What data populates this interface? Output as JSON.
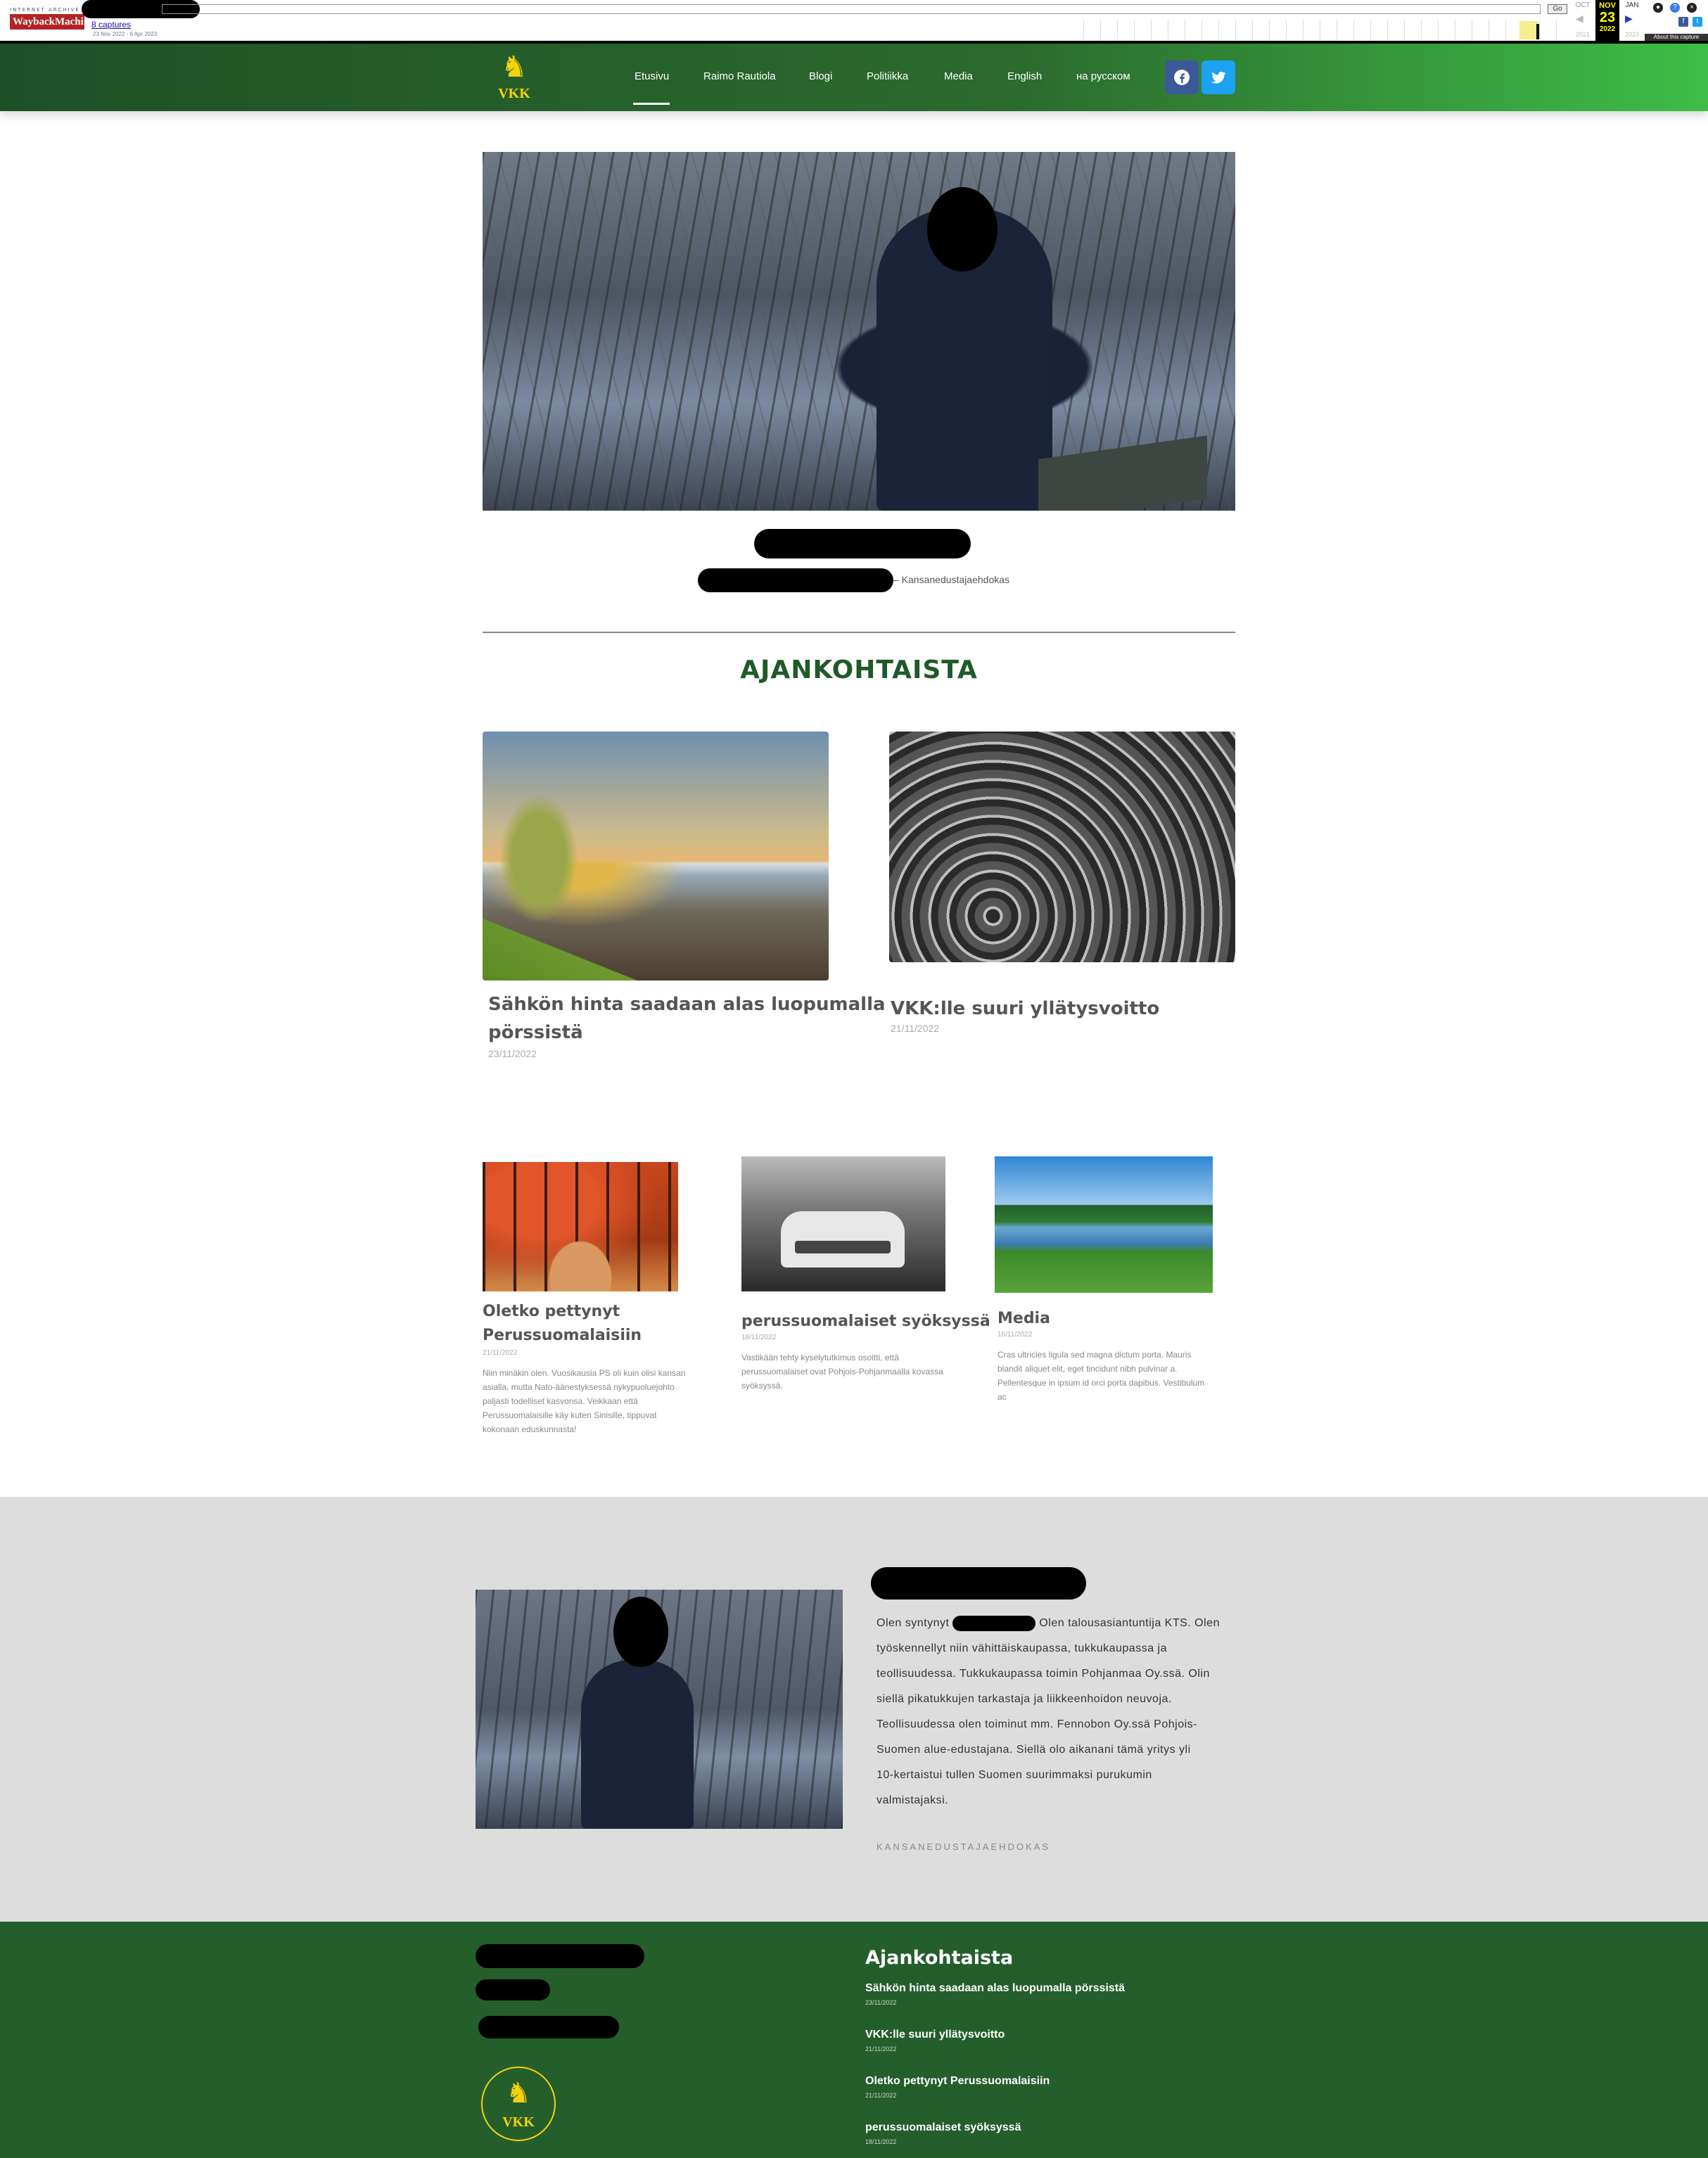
{
  "wayback": {
    "logo_top": "INTERNET ARCHIVE",
    "logo_main": "WaybackMachine",
    "captures": "8 captures",
    "range": "23 Nov 2022 - 6 Apr 2023",
    "go": "Go",
    "months": {
      "prev": "OCT",
      "current": "NOV",
      "next": "JAN"
    },
    "day": "23",
    "years": {
      "prev": "2021",
      "current": "2022",
      "next": "2023"
    },
    "about": "About this capture"
  },
  "header": {
    "logo_text": "VKK",
    "nav": [
      "Etusivu",
      "Raimo Rautiola",
      "Blogi",
      "Politiikka",
      "Media",
      "English",
      "на русском"
    ],
    "active_index": 0,
    "social": [
      "facebook-icon",
      "twitter-icon"
    ],
    "colors": {
      "header_start": "#1e5025",
      "header_end": "#3dbd48",
      "gold": "#f5d20b",
      "facebook": "#3b5998",
      "twitter": "#1da1f2"
    }
  },
  "hero": {
    "candidate_label": "– Kansanedustajaehdokas"
  },
  "section": {
    "title": "AJANKOHTAISTA",
    "title_color": "#1f5a28"
  },
  "featured": [
    {
      "title_line1": "Sähkön hinta saadaan alas luopumalla",
      "title_line2": "pörssistä",
      "date": "23/11/2022"
    },
    {
      "title": "VKK:lle suuri yllätysvoitto",
      "date": "21/11/2022"
    }
  ],
  "posts": [
    {
      "title_line1": "Oletko pettynyt",
      "title_line2": "Perussuomalaisiin",
      "date": "21/11/2022",
      "excerpt": [
        "Niin minäkin olen. Vuosikausia PS oli kuin olisi kansan",
        "asialla, mutta Nato-äänestyksessä nykypuoluejohto",
        "paljasti todelliset kasvonsa. Veikkaan että",
        "Perussuomalaisille käy kuten Sinisille, tippuvat",
        "kokonaan eduskunnasta!"
      ]
    },
    {
      "title": "perussuomalaiset syöksyssä",
      "date": "18/11/2022",
      "excerpt": [
        "Vastikään tehty kyselytutkimus osoitti, että",
        "perussuomalaiset ovat Pohjois-Pohjanmaalla kovassa",
        "syöksyssä."
      ]
    },
    {
      "title": "Media",
      "date": "16/11/2022",
      "excerpt": [
        "Cras ultricies ligula sed magna dictum porta. Mauris",
        "blandit aliquet elit, eget tincidunt nibh pulvinar a.",
        "Pellentesque in ipsum id orci porta dapibus. Vestibulum",
        "ac"
      ]
    }
  ],
  "bio": {
    "line1_start": "Olen syntynyt",
    "line1_end": "Olen talousasiantuntija KTS. Olen",
    "lines": [
      "työskennellyt niin vähittäiskaupassa, tukkukaupassa ja",
      "teollisuudessa. Tukkukaupassa toimin Pohjanmaa Oy.ssä. Olin",
      "siellä pikatukkujen tarkastaja ja liikkeenhoidon neuvoja.",
      "Teollisuudessa olen toiminut mm. Fennobon Oy.ssä Pohjois-",
      "Suomen alue-edustajana. Siellä olo aikanani tämä yritys yli",
      "10-kertaistui tullen Suomen suurimmaksi purukumin",
      "valmistajaksi."
    ],
    "role": "KANSANEDUSTAJAEHDOKAS"
  },
  "footer": {
    "logo_text": "VKK",
    "heading": "Ajankohtaista",
    "links": [
      {
        "title": "Sähkön hinta saadaan alas luopumalla pörssistä",
        "date": "23/11/2022"
      },
      {
        "title": "VKK:lle suuri yllätysvoitto",
        "date": "21/11/2022"
      },
      {
        "title": "Oletko pettynyt Perussuomalaisiin",
        "date": "21/11/2022"
      },
      {
        "title": "perussuomalaiset syöksyssä",
        "date": "18/11/2022"
      }
    ],
    "background": "#245e2b"
  }
}
